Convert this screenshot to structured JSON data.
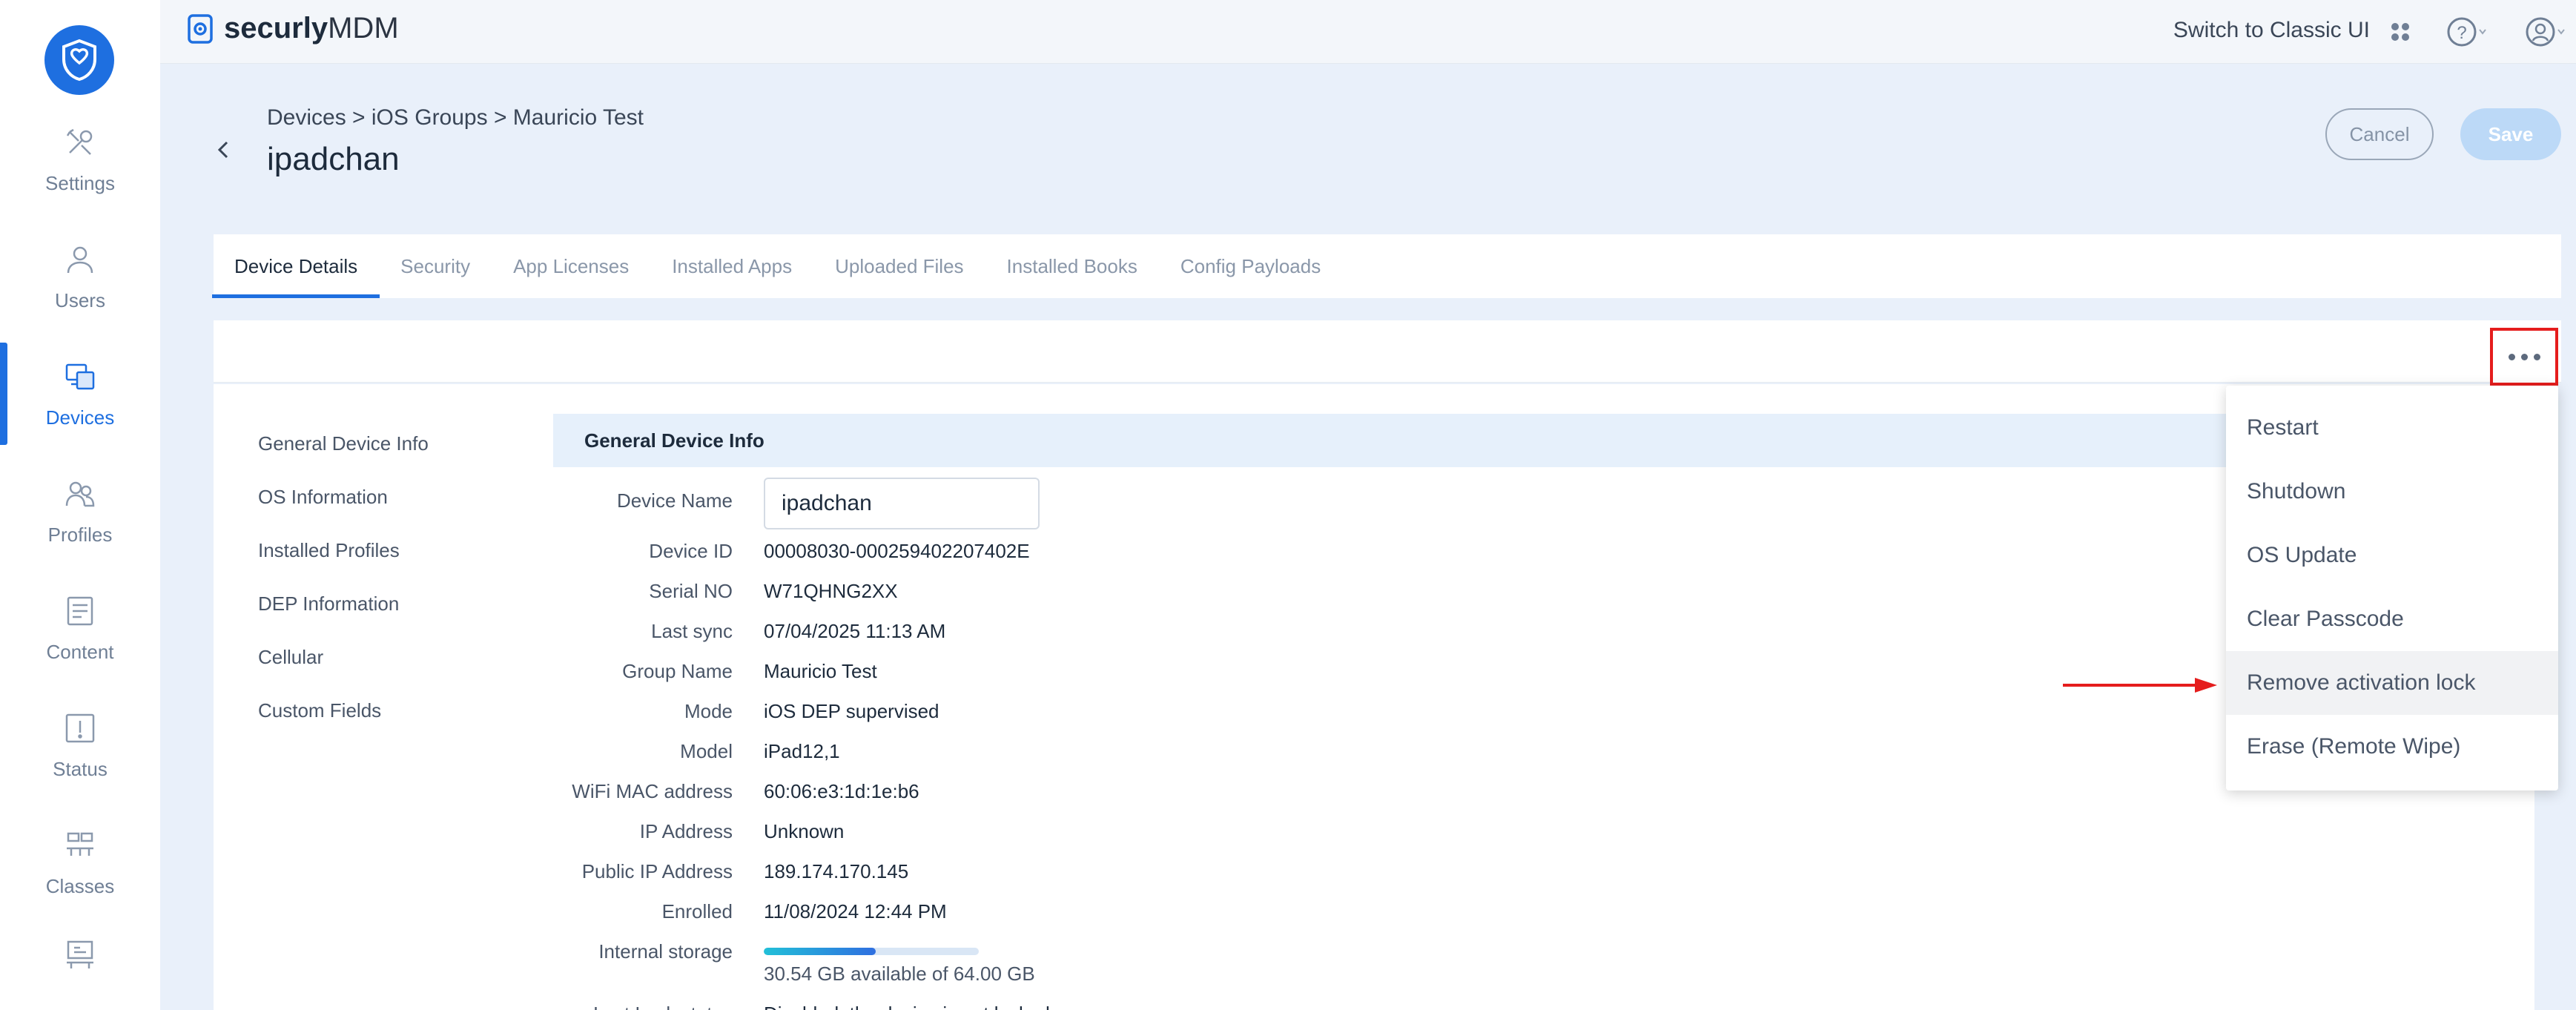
{
  "brand": {
    "name_bold": "securly",
    "name_rest": "MDM"
  },
  "topbar": {
    "switch_label": "Switch to Classic UI"
  },
  "sidebar": {
    "items": [
      {
        "label": "Settings",
        "icon": "tools-icon"
      },
      {
        "label": "Users",
        "icon": "user-icon"
      },
      {
        "label": "Devices",
        "icon": "devices-icon",
        "active": true
      },
      {
        "label": "Profiles",
        "icon": "profiles-icon"
      },
      {
        "label": "Content",
        "icon": "document-icon"
      },
      {
        "label": "Status",
        "icon": "status-icon"
      },
      {
        "label": "Classes",
        "icon": "classes-icon"
      }
    ]
  },
  "header": {
    "breadcrumb": "Devices > iOS Groups > Mauricio Test",
    "title": "ipadchan",
    "cancel_label": "Cancel",
    "save_label": "Save"
  },
  "tabs": [
    {
      "label": "Device Details",
      "active": true
    },
    {
      "label": "Security"
    },
    {
      "label": "App Licenses"
    },
    {
      "label": "Installed Apps"
    },
    {
      "label": "Uploaded Files"
    },
    {
      "label": "Installed Books"
    },
    {
      "label": "Config Payloads"
    }
  ],
  "section_nav": [
    "General Device Info",
    "OS Information",
    "Installed Profiles",
    "DEP Information",
    "Cellular",
    "Custom Fields"
  ],
  "section_header": "General Device Info",
  "fields": {
    "device_name_label": "Device Name",
    "device_name_value": "ipadchan",
    "rows": [
      {
        "label": "Device ID",
        "value": "00008030-000259402207402E"
      },
      {
        "label": "Serial NO",
        "value": "W71QHNG2XX"
      },
      {
        "label": "Last sync",
        "value": "07/04/2025 11:13 AM"
      },
      {
        "label": "Group Name",
        "value": "Mauricio Test"
      },
      {
        "label": "Mode",
        "value": "iOS DEP supervised"
      },
      {
        "label": "Model",
        "value": "iPad12,1"
      },
      {
        "label": "WiFi MAC address",
        "value": "60:06:e3:1d:1e:b6"
      },
      {
        "label": "IP Address",
        "value": "Unknown"
      },
      {
        "label": "Public IP Address",
        "value": "189.174.170.145"
      },
      {
        "label": "Enrolled",
        "value": "11/08/2024 12:44 PM"
      }
    ],
    "storage_label": "Internal storage",
    "storage_text": "30.54 GB available of 64.00 GB",
    "storage_used_fraction": 0.52,
    "cut_label": "Last Lock status",
    "cut_value": "Disabled: the device is not locked"
  },
  "dropdown": {
    "items": [
      "Restart",
      "Shutdown",
      "OS Update",
      "Clear Passcode",
      "Remove activation lock",
      "Erase (Remote Wipe)"
    ],
    "highlighted_index": 4
  },
  "colors": {
    "accent": "#1e6fe0",
    "highlight_border": "#e51d1d",
    "background": "#e9f0fa"
  }
}
